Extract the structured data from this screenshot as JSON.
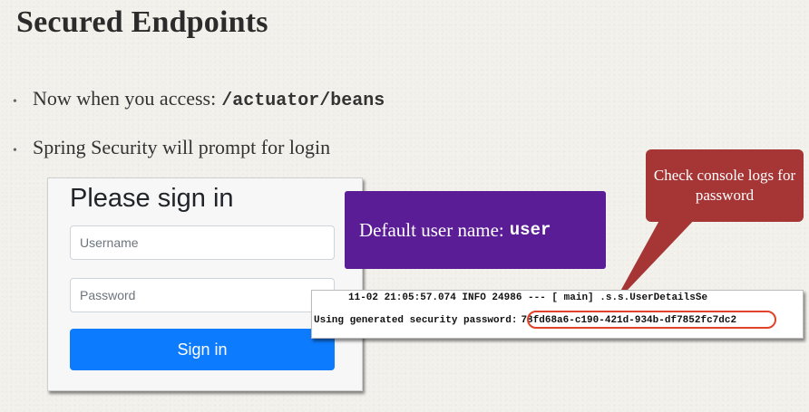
{
  "slide": {
    "title": "Secured Endpoints",
    "bullets": [
      {
        "text": "Now when you access:",
        "code": "/actuator/beans"
      },
      {
        "text": "Spring Security will prompt for login"
      }
    ]
  },
  "signin": {
    "heading": "Please sign in",
    "username_placeholder": "Username",
    "password_placeholder": "Password",
    "button_label": "Sign in"
  },
  "callout_user": {
    "text": "Default user name:",
    "code": "user",
    "color": "#5a1d96"
  },
  "callout_console": {
    "text": "Check console logs for password",
    "color": "#a63535"
  },
  "console": {
    "line1": "11-02 21:05:57.074  INFO 24986 --- [           main] .s.s.UserDetailsSe",
    "line2_label": "Using generated security password:",
    "password": "78fd68a6-c190-421d-934b-df7852fc7dc2",
    "highlight_color": "#e2412a"
  },
  "colors": {
    "button": "#0d7bfd",
    "background": "#f3f1ec"
  }
}
